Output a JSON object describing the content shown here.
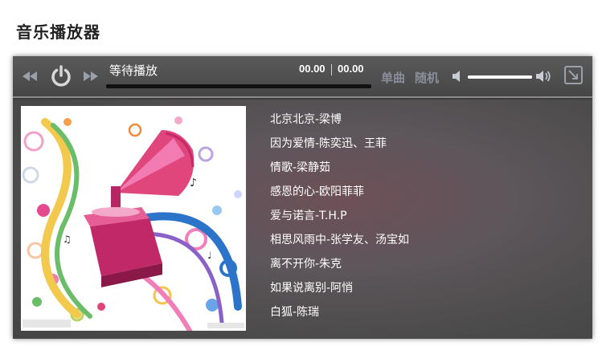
{
  "page": {
    "title": "音乐播放器"
  },
  "player": {
    "status_text": "等待播放",
    "time_current": "00.00",
    "time_total": "00.00",
    "progress_fraction": 0,
    "mode_single_label": "单曲",
    "mode_random_label": "随机",
    "volume_fraction": 1.0,
    "icons": {
      "prev": "rewind-icon",
      "play": "power-icon",
      "next": "fast-forward-icon",
      "mute": "speaker-icon",
      "volume_max": "speaker-loud-icon",
      "fullscreen": "fullscreen-icon"
    },
    "colors": {
      "bar": "#474747",
      "mode_text": "#8a8e9a"
    }
  },
  "playlist": [
    {
      "label": "北京北京-梁博"
    },
    {
      "label": "因为爱情-陈奕迅、王菲"
    },
    {
      "label": "情歌-梁静茹"
    },
    {
      "label": "感恩的心-欧阳菲菲"
    },
    {
      "label": "爱与诺言-T.H.P"
    },
    {
      "label": "相思风雨中-张学友、汤宝如"
    },
    {
      "label": "离不开你-朱克"
    },
    {
      "label": "如果说离别-阿悄"
    },
    {
      "label": "白狐-陈瑞"
    }
  ]
}
